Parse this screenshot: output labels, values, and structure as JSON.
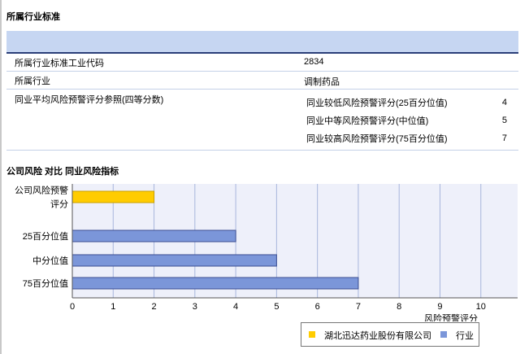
{
  "section1": {
    "title": "所属行业标准"
  },
  "table": {
    "sic_label": "所属行业标准工业代码",
    "sic_value": "2834",
    "industry_label": "所属行业",
    "industry_value": "调制药品",
    "avg_label": "同业平均风险预警评分参照(四等分数)",
    "sub": [
      {
        "label": "同业较低风险预警评分(25百分位值)",
        "value": "4"
      },
      {
        "label": "同业中等风险预警评分(中位值)",
        "value": "5"
      },
      {
        "label": "同业较高风险预警评分(75百分位值)",
        "value": "7"
      }
    ]
  },
  "section2": {
    "title": "公司风险 对比 同业风险指标"
  },
  "chart_data": {
    "type": "bar",
    "orientation": "horizontal",
    "categories": [
      "公司风险预警评分",
      "25百分位值",
      "中分位值",
      "75百分位值"
    ],
    "category_lines": [
      [
        "公司风险预警",
        "评分"
      ],
      [
        "25百分位值"
      ],
      [
        "中分位值"
      ],
      [
        "75百分位值"
      ]
    ],
    "series": [
      {
        "name": "湖北迅达药业股份有限公司",
        "values": [
          2,
          null,
          null,
          null
        ],
        "color": "#ffcc00"
      },
      {
        "name": "行业",
        "values": [
          null,
          4,
          5,
          7
        ],
        "color": "#7b96d9"
      }
    ],
    "xlabel": "风险预警评分",
    "xlim": [
      0,
      10.9
    ],
    "xticks": [
      0,
      1,
      2,
      3,
      4,
      5,
      6,
      7,
      8,
      9,
      10
    ],
    "grid": true,
    "legend_position": "bottom-right",
    "colors": {
      "plot_bg": "#eef0fa",
      "grid": "#a8b6dc",
      "axis": "#555555"
    }
  }
}
